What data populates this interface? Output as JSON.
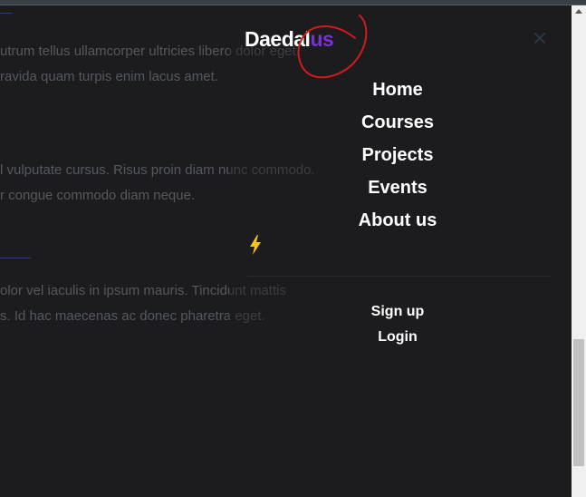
{
  "background_page": {
    "paragraph_1": [
      "utrum tellus ullamcorper ultricies libero dolor eget.",
      "ravida quam turpis enim lacus amet."
    ],
    "paragraph_2": [
      "l vulputate cursus. Risus proin diam nunc commodo.",
      "r congue commodo diam neque."
    ],
    "paragraph_3": [
      "olor vel iaculis in ipsum mauris. Tincidunt mattis",
      "s. Id hac maecenas ac donec pharetra eget."
    ]
  },
  "logo": {
    "prefix": "Daedal",
    "accent": "us",
    "accent_color": "#7b2fd6"
  },
  "nav": {
    "items": [
      "Home",
      "Courses",
      "Projects",
      "Events",
      "About us"
    ]
  },
  "auth": {
    "signup": "Sign up",
    "login": "Login"
  },
  "icons": {
    "theme_toggle": "lightning-bolt-icon",
    "close": "close-icon"
  },
  "colors": {
    "background": "#1d1d1f",
    "bolt": "#f5c518",
    "annotation": "#d11a1a"
  }
}
